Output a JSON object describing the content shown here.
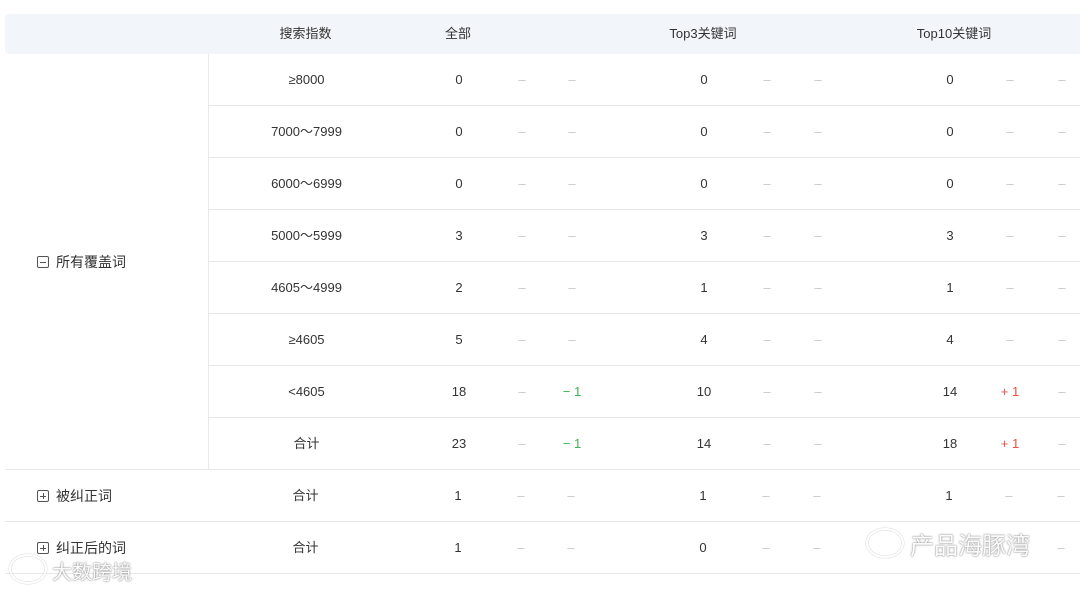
{
  "header": {
    "search_index": "搜索指数",
    "all": "全部",
    "top3": "Top3关键词",
    "top10": "Top10关键词"
  },
  "dash": "–",
  "groups": [
    {
      "label": "所有覆盖词",
      "expanded": true,
      "rows": [
        {
          "range": "≥8000",
          "all": "0",
          "all_d1": "–",
          "all_d2": "–",
          "top3": "0",
          "top3_d1": "–",
          "top3_d2": "–",
          "top10": "0",
          "top10_d1": "–",
          "top10_d2": "–"
        },
        {
          "range": "7000～7999",
          "all": "0",
          "all_d1": "–",
          "all_d2": "–",
          "top3": "0",
          "top3_d1": "–",
          "top3_d2": "–",
          "top10": "0",
          "top10_d1": "–",
          "top10_d2": "–"
        },
        {
          "range": "6000～6999",
          "all": "0",
          "all_d1": "–",
          "all_d2": "–",
          "top3": "0",
          "top3_d1": "–",
          "top3_d2": "–",
          "top10": "0",
          "top10_d1": "–",
          "top10_d2": "–"
        },
        {
          "range": "5000～5999",
          "all": "3",
          "all_d1": "–",
          "all_d2": "–",
          "top3": "3",
          "top3_d1": "–",
          "top3_d2": "–",
          "top10": "3",
          "top10_d1": "–",
          "top10_d2": "–"
        },
        {
          "range": "4605～4999",
          "all": "2",
          "all_d1": "–",
          "all_d2": "–",
          "top3": "1",
          "top3_d1": "–",
          "top3_d2": "–",
          "top10": "1",
          "top10_d1": "–",
          "top10_d2": "–"
        },
        {
          "range": "≥4605",
          "all": "5",
          "all_d1": "–",
          "all_d2": "–",
          "top3": "4",
          "top3_d1": "–",
          "top3_d2": "–",
          "top10": "4",
          "top10_d1": "–",
          "top10_d2": "–"
        },
        {
          "range": "<4605",
          "all": "18",
          "all_d1": "–",
          "all_d2": "− 1",
          "top3": "10",
          "top3_d1": "–",
          "top3_d2": "–",
          "top10": "14",
          "top10_d1": "+ 1",
          "top10_d2": "–"
        },
        {
          "range": "合计",
          "all": "23",
          "all_d1": "–",
          "all_d2": "− 1",
          "top3": "14",
          "top3_d1": "–",
          "top3_d2": "–",
          "top10": "18",
          "top10_d1": "+ 1",
          "top10_d2": "–"
        }
      ]
    },
    {
      "label": "被纠正词",
      "expanded": false,
      "rows": [
        {
          "range": "合计",
          "all": "1",
          "all_d1": "–",
          "all_d2": "–",
          "top3": "1",
          "top3_d1": "–",
          "top3_d2": "–",
          "top10": "1",
          "top10_d1": "–",
          "top10_d2": "–"
        }
      ]
    },
    {
      "label": "纠正后的词",
      "expanded": false,
      "rows": [
        {
          "range": "合计",
          "all": "1",
          "all_d1": "–",
          "all_d2": "–",
          "top3": "0",
          "top3_d1": "–",
          "top3_d2": "–",
          "top10": "",
          "top10_d1": "",
          "top10_d2": "–"
        }
      ]
    }
  ],
  "watermarks": {
    "left": "大数跨境",
    "right": "产品海豚湾"
  },
  "colors": {
    "header_bg": "#f2f5f9",
    "border": "#e8e8e8",
    "dash": "#c8c8c8",
    "decrease": "#3fb34f",
    "increase": "#f04f43"
  }
}
